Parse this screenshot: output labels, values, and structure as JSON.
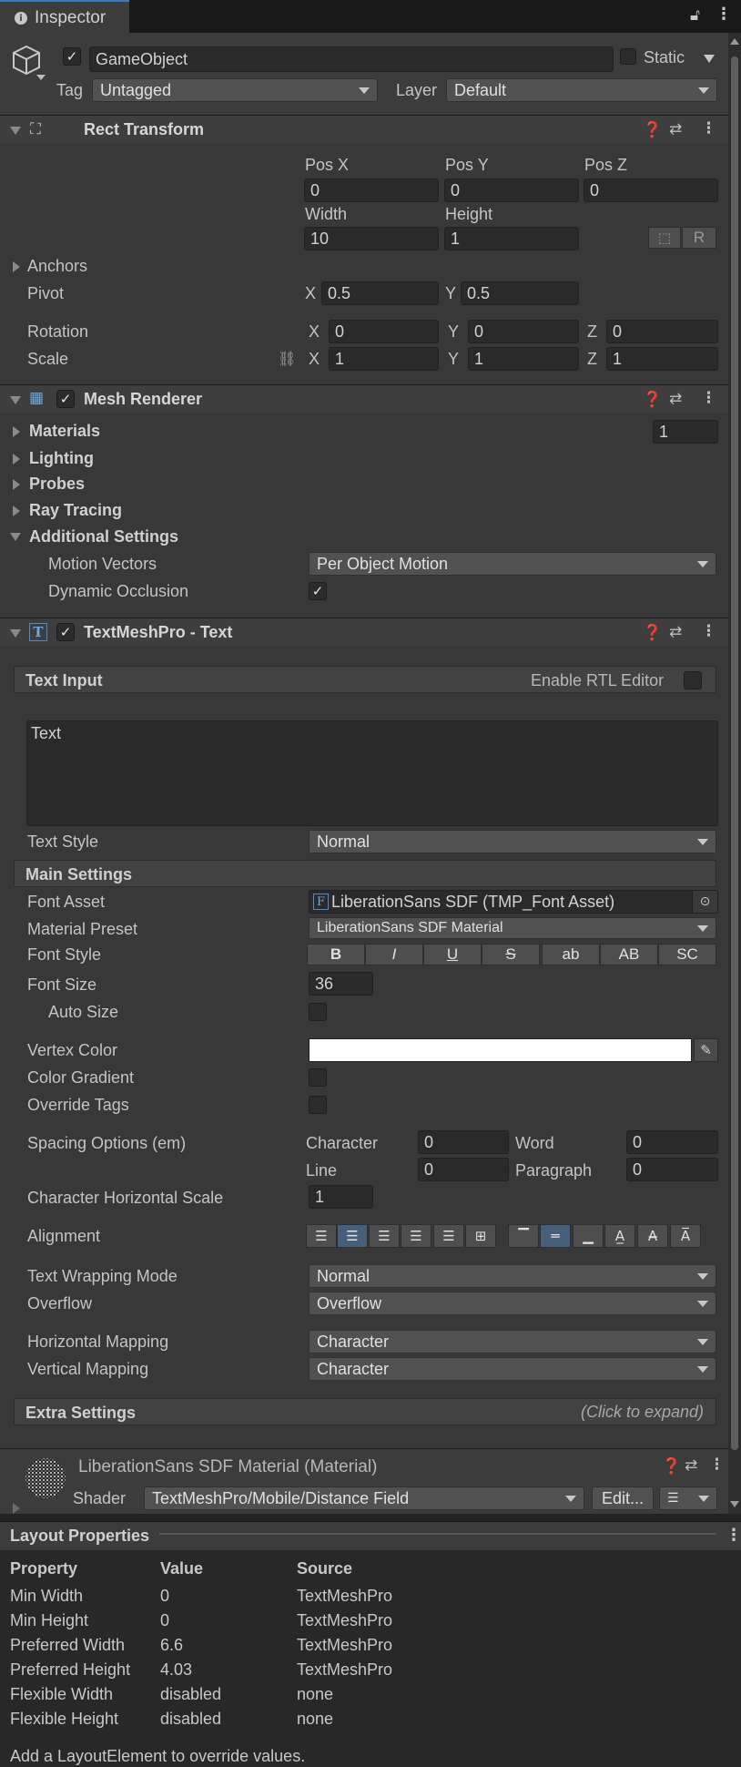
{
  "tab": {
    "title": "Inspector"
  },
  "gameobject": {
    "name": "GameObject",
    "static_label": "Static",
    "tag_label": "Tag",
    "tag_value": "Untagged",
    "layer_label": "Layer",
    "layer_value": "Default"
  },
  "rect_transform": {
    "title": "Rect Transform",
    "pos_x_label": "Pos X",
    "pos_y_label": "Pos Y",
    "pos_z_label": "Pos Z",
    "pos_x": "0",
    "pos_y": "0",
    "pos_z": "0",
    "width_label": "Width",
    "height_label": "Height",
    "width": "10",
    "height": "1",
    "r_button": "R",
    "anchors_label": "Anchors",
    "pivot_label": "Pivot",
    "pivot_x": "0.5",
    "pivot_y": "0.5",
    "rotation_label": "Rotation",
    "rot_x": "0",
    "rot_y": "0",
    "rot_z": "0",
    "scale_label": "Scale",
    "scale_x": "1",
    "scale_y": "1",
    "scale_z": "1",
    "x": "X",
    "y": "Y",
    "z": "Z"
  },
  "mesh_renderer": {
    "title": "Mesh Renderer",
    "materials_label": "Materials",
    "materials_count": "1",
    "lighting_label": "Lighting",
    "probes_label": "Probes",
    "ray_tracing_label": "Ray Tracing",
    "additional_label": "Additional Settings",
    "motion_vectors_label": "Motion Vectors",
    "motion_vectors_value": "Per Object Motion",
    "dynamic_occlusion_label": "Dynamic Occlusion"
  },
  "tmp": {
    "title": "TextMeshPro - Text",
    "text_input_label": "Text Input",
    "rtl_label": "Enable RTL Editor",
    "text_value": "Text",
    "text_style_label": "Text Style",
    "text_style_value": "Normal",
    "main_settings_label": "Main Settings",
    "font_asset_label": "Font Asset",
    "font_asset_value": "LiberationSans SDF (TMP_Font Asset)",
    "material_preset_label": "Material Preset",
    "material_preset_value": "LiberationSans SDF Material",
    "font_style_label": "Font Style",
    "font_style_buttons": [
      "B",
      "I",
      "U",
      "S",
      "ab",
      "AB",
      "SC"
    ],
    "font_size_label": "Font Size",
    "font_size_value": "36",
    "auto_size_label": "Auto Size",
    "vertex_color_label": "Vertex Color",
    "color_gradient_label": "Color Gradient",
    "override_tags_label": "Override Tags",
    "spacing_label": "Spacing Options (em)",
    "character_label": "Character",
    "character_value": "0",
    "word_label": "Word",
    "word_value": "0",
    "line_label": "Line",
    "line_value": "0",
    "paragraph_label": "Paragraph",
    "paragraph_value": "0",
    "char_h_scale_label": "Character Horizontal Scale",
    "char_h_scale_value": "1",
    "alignment_label": "Alignment",
    "wrapping_label": "Text Wrapping Mode",
    "wrapping_value": "Normal",
    "overflow_label": "Overflow",
    "overflow_value": "Overflow",
    "h_mapping_label": "Horizontal Mapping",
    "h_mapping_value": "Character",
    "v_mapping_label": "Vertical Mapping",
    "v_mapping_value": "Character",
    "extra_label": "Extra Settings",
    "extra_hint": "(Click to expand)"
  },
  "material": {
    "title": "LiberationSans SDF Material (Material)",
    "shader_label": "Shader",
    "shader_value": "TextMeshPro/Mobile/Distance Field",
    "edit_button": "Edit..."
  },
  "layout": {
    "title": "Layout Properties",
    "headers": [
      "Property",
      "Value",
      "Source"
    ],
    "rows": [
      [
        "Min Width",
        "0",
        "TextMeshPro"
      ],
      [
        "Min Height",
        "0",
        "TextMeshPro"
      ],
      [
        "Preferred Width",
        "6.6",
        "TextMeshPro"
      ],
      [
        "Preferred Height",
        "4.03",
        "TextMeshPro"
      ],
      [
        "Flexible Width",
        "disabled",
        "none"
      ],
      [
        "Flexible Height",
        "disabled",
        "none"
      ]
    ],
    "footer": "Add a LayoutElement to override values."
  },
  "colors": {
    "accent": "#3a79bb",
    "selected": "#46607c",
    "vertex_color": "#ffffff"
  }
}
